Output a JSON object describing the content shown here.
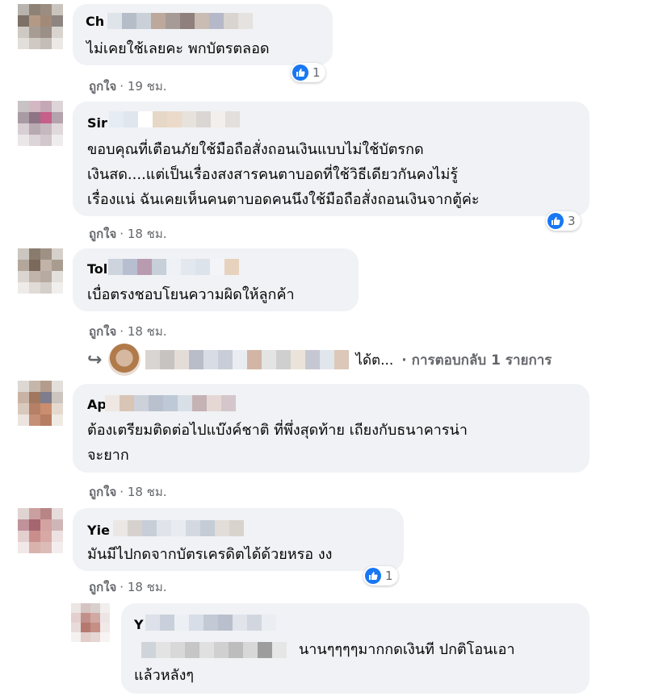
{
  "comments": [
    {
      "author": "Ch",
      "text_lines": [
        "ไม่เคยใช้เลยคะ พกบัตรตลอด"
      ],
      "like_label": "ถูกใจ",
      "time": "· 19 ชม.",
      "reaction_count": "1"
    },
    {
      "author": "Sir",
      "text_lines": [
        "ขอบคุณที่เตือนภัยใช้มือถือสั่งถอนเงินแบบไม่ใช้บัตรกด",
        "เงินสด....แต่เป็นเรื่องสงสารคนตาบอดที่ใช้วิธีเดียวกันคงไม่รู้",
        "เรื่องแน่ ฉันเคยเห็นคนตาบอดคนนึงใช้มือถือสั่งถอนเงินจากตู้ค่ะ"
      ],
      "like_label": "ถูกใจ",
      "time": "· 18 ชม.",
      "reaction_count": "3"
    },
    {
      "author": "Tol",
      "text_lines": [
        "เบื่อตรงชอบโยนความผิดให้ลูกค้า"
      ],
      "like_label": "ถูกใจ",
      "time": "· 18 ชม.",
      "replies": {
        "prefix": "ได้ต...",
        "summary": "· การตอบกลับ 1 รายการ"
      }
    },
    {
      "author": "Ap",
      "text_lines": [
        "ต้องเตรียมติดต่อไปแบ๊งค์ชาติ ที่พึ่งสุดท้าย เถียงกับธนาคารน่า",
        "จะยาก"
      ],
      "like_label": "ถูกใจ",
      "time": "· 18 ชม."
    },
    {
      "author": "Yie",
      "text_lines": [
        "มันมีไปกดจากบัตรเครดิตได้ด้วยหรอ งง"
      ],
      "like_label": "ถูกใจ",
      "time": "· 18 ชม.",
      "reaction_count": "1"
    },
    {
      "author": "Y",
      "text_lines": [
        "นานๆๆๆๆมากกดเงินที ปกติโอนเอา",
        "แล้วหลังๆ"
      ]
    }
  ],
  "colors": {
    "like_blue": "#1877f2",
    "bubble_bg": "#f0f2f5",
    "meta_gray": "#65676b"
  },
  "icons": {
    "reaction": "like-thumb-icon",
    "reply": "reply-arrow-icon"
  }
}
